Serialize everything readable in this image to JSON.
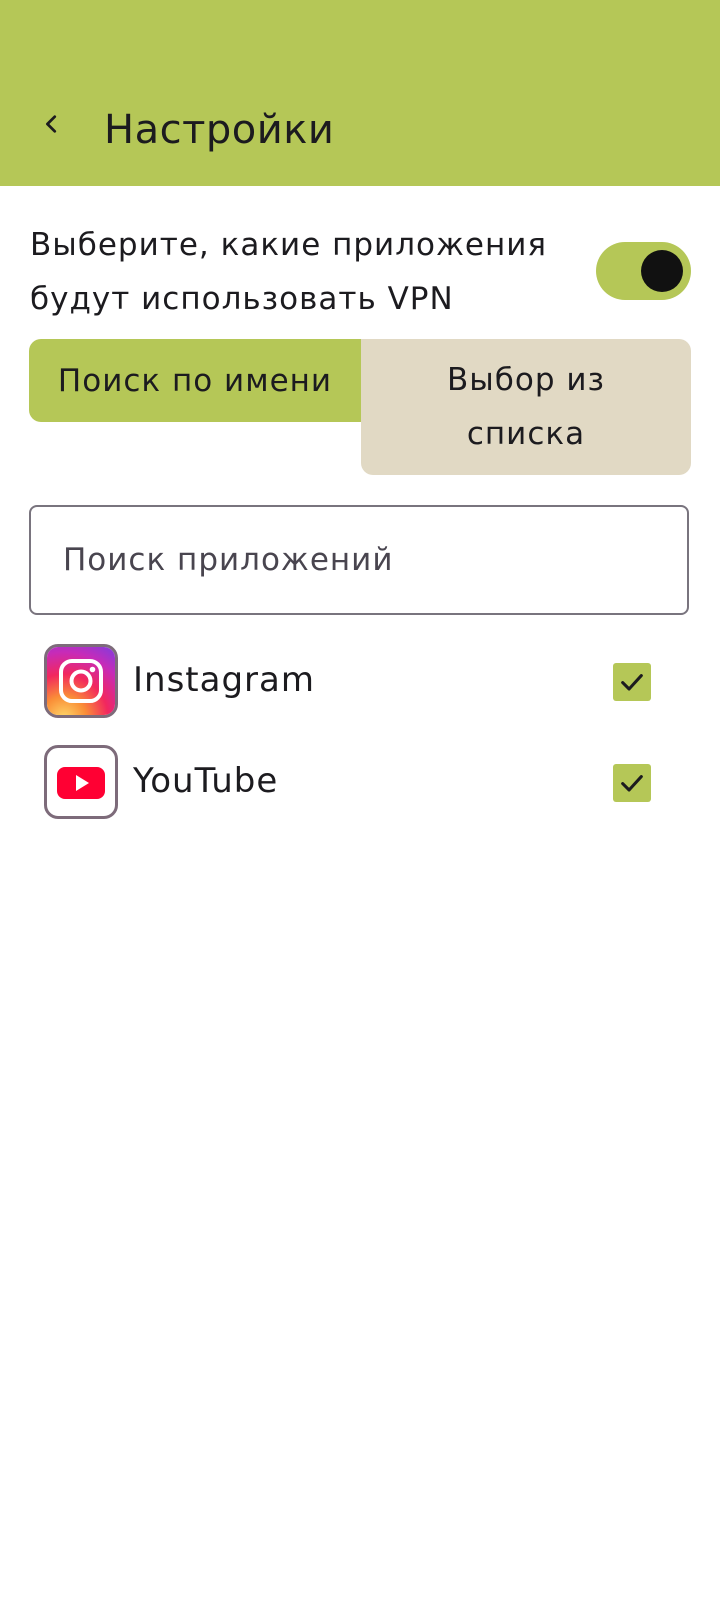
{
  "header": {
    "back_icon": "chevron-left-icon",
    "title": "Настройки"
  },
  "vpn_selection": {
    "label": "Выберите, какие приложения будут использовать VPN",
    "toggle_on": true
  },
  "mode_tabs": {
    "search_by_name": "Поиск по имени",
    "choose_from_list_line1": "Выбор из",
    "choose_from_list_line2": "списка",
    "active": "search_by_name"
  },
  "search": {
    "placeholder": "Поиск приложений",
    "value": ""
  },
  "apps": [
    {
      "name": "Instagram",
      "icon": "instagram-icon",
      "checked": true
    },
    {
      "name": "YouTube",
      "icon": "youtube-icon",
      "checked": true
    }
  ],
  "colors": {
    "accent": "#b5c757",
    "inactive_tab": "#e1d9c4",
    "youtube_red": "#ff0033"
  }
}
